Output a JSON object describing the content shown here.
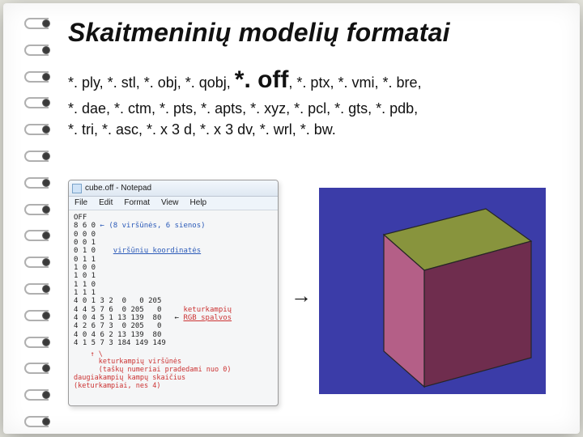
{
  "title": "Skaitmeninių modelių formatai",
  "formats": {
    "line1_a": "*. ply, *. stl, *. obj, *. qobj, ",
    "big": "*. off",
    "line1_b": ", *. ptx, *. vmi, *. bre,",
    "line2": "*. dae, *. ctm, *. pts, *. apts, *. xyz, *. pcl, *. gts, *. pdb,",
    "line3": "*. tri, *. asc, *. x 3 d, *. x 3 dv, *. wrl, *. bw."
  },
  "notepad": {
    "window_title": "cube.off - Notepad",
    "menus": [
      "File",
      "Edit",
      "Format",
      "View",
      "Help"
    ],
    "header_line": "OFF",
    "counts_line": "8 6 0",
    "counts_annot": "← (8 viršūnės, 6 sienos)",
    "vertices": [
      "0 0 0",
      "0 0 1",
      "0 1 0",
      "0 1 1",
      "1 0 0",
      "1 0 1",
      "1 1 0",
      "1 1 1"
    ],
    "vertices_annot": "viršūnių koordinatės",
    "faces": [
      "4 0 1 3 2  0   0 205",
      "4 4 5 7 6  0 205   0",
      "4 0 4 5 1 13 139  80",
      "4 2 6 7 3  0 205   0",
      "4 0 4 6 2 13 139  80",
      "4 1 5 7 3 184 149 149"
    ],
    "face_annot_right1": "keturkampių",
    "face_annot_right2": "RGB spalvos",
    "bottom_annot1": "keturkampių viršūnės",
    "bottom_annot2": "(taškų numeriai pradedami nuo 0)",
    "bottom_annot3": "daugiakampių kampų skaičius",
    "bottom_annot4": "(keturkampiai, nes 4)"
  },
  "arrow_glyph": "→",
  "cube": {
    "top_fill": "#88943d",
    "left_fill": "#b45f87",
    "right_fill": "#6f2d4e",
    "bg": "#3b3ca8"
  }
}
